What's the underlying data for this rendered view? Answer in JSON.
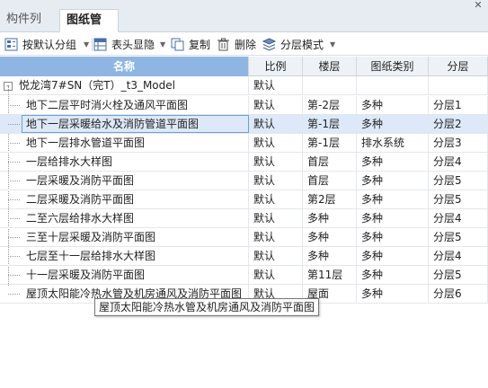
{
  "tabs": [
    {
      "label": "构件列表",
      "active": false
    },
    {
      "label": "图纸管理",
      "active": true
    }
  ],
  "toolbar": {
    "sort_default": "按默认分组",
    "header_toggle": "表头显隐",
    "copy": "复制",
    "delete": "删除",
    "layer_mode": "分层模式"
  },
  "columns": {
    "name": "名称",
    "scale": "比例",
    "floor": "楼层",
    "category": "图纸类别",
    "layer": "分层"
  },
  "root": {
    "expander": "-",
    "name": "悦龙湾7#SN（完T）_t3_Model",
    "scale": "默认"
  },
  "rows": [
    {
      "name": "地下二层平时消火栓及通风平面图",
      "scale": "默认",
      "floor": "第-2层",
      "category": "多种",
      "layer": "分层1"
    },
    {
      "name": "地下一层采暖给水及消防管道平面图",
      "scale": "默认",
      "floor": "第-1层",
      "category": "多种",
      "layer": "分层2"
    },
    {
      "name": "地下一层排水管道平面图",
      "scale": "默认",
      "floor": "第-1层",
      "category": "排水系统",
      "layer": "分层3"
    },
    {
      "name": "一层给排水大样图",
      "scale": "默认",
      "floor": "首层",
      "category": "多种",
      "layer": "分层4"
    },
    {
      "name": "一层采暖及消防平面图",
      "scale": "默认",
      "floor": "首层",
      "category": "多种",
      "layer": "分层5"
    },
    {
      "name": "二层采暖及消防平面图",
      "scale": "默认",
      "floor": "第2层",
      "category": "多种",
      "layer": "分层5"
    },
    {
      "name": "二至六层给排水大样图",
      "scale": "默认",
      "floor": "多种",
      "category": "多种",
      "layer": "分层4"
    },
    {
      "name": "三至十层采暖及消防平面图",
      "scale": "默认",
      "floor": "多种",
      "category": "多种",
      "layer": "分层5"
    },
    {
      "name": "七层至十一层给排水大样图",
      "scale": "默认",
      "floor": "多种",
      "category": "多种",
      "layer": "分层4"
    },
    {
      "name": "十一层采暖及消防平面图",
      "scale": "默认",
      "floor": "第11层",
      "category": "多种",
      "layer": "分层5"
    },
    {
      "name": "屋顶太阳能冷热水管及机房通风及消防平面图",
      "scale": "默认",
      "floor": "屋面",
      "category": "多种",
      "layer": "分层6"
    }
  ],
  "selected_row": 1,
  "tooltip": "屋顶太阳能冷热水管及机房通风及消防平面图",
  "colors": {
    "header_active": "#8fb6e3",
    "selection": "#dde9f8"
  }
}
